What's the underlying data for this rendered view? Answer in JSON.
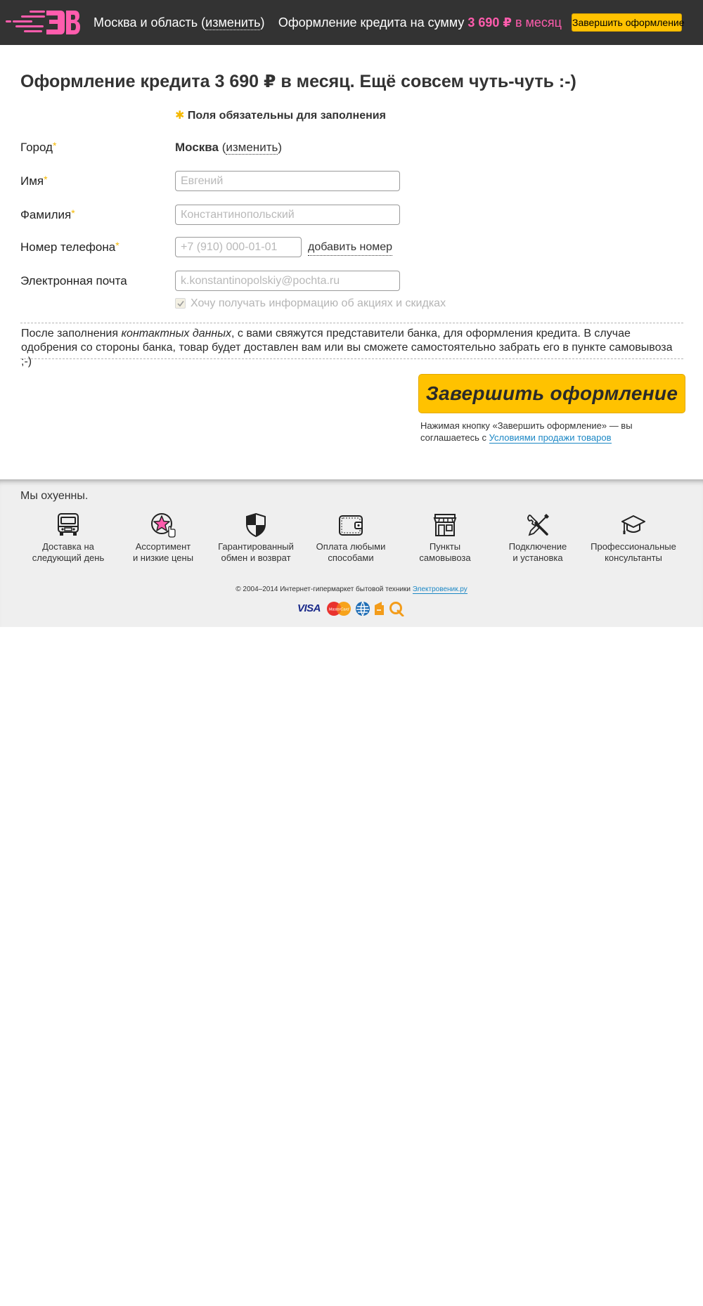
{
  "header": {
    "region_prefix": "Москва и область (",
    "region_change": "изменить",
    "region_suffix": ")",
    "credit_text": "Оформление кредита на сумму",
    "credit_amount": "3 690 ₽",
    "credit_period": "в месяц",
    "finish_button": "Завершить оформление"
  },
  "main": {
    "title_prefix": "Оформление кредита",
    "title_amount": "3 690 ₽",
    "title_suffix": "в месяц. Ещё совсем чуть-чуть :-)",
    "required_star": "✱",
    "required_note": "Поля обязательны для заполнения",
    "required_mark": "*",
    "city": {
      "label": "Город",
      "value": "Москва",
      "change_prefix": "(",
      "change_link": "изменить",
      "change_suffix": ")"
    },
    "first_name": {
      "label": "Имя",
      "placeholder": "Евгений"
    },
    "last_name": {
      "label": "Фамилия",
      "placeholder": "Константинопольский"
    },
    "phone": {
      "label": "Номер телефона",
      "placeholder": "+7 (910) 000-01-01",
      "add_link": "добавить номер"
    },
    "email": {
      "label": "Электронная почта",
      "placeholder": "k.konstantinopolskiy@pochta.ru"
    },
    "subscribe": {
      "label": "Хочу получать информацию об акциях и скидках",
      "checked": true
    },
    "info": {
      "before": "После заполнения ",
      "italic": "контактных данных",
      "after": ", с вами свяжутся представители банка, для оформления кредита. В случае одобрения со стороны банка, товар будет доставлен вам или вы сможете самостоятельно забрать его в пункте самовывоза ;-)"
    },
    "submit_button": "Завершить оформление",
    "agree_text": "Нажимая кнопку «Завершить оформление» — вы соглашаетесь с",
    "agree_link": "Условиями продажи товаров"
  },
  "footer": {
    "tagline": "Мы охуенны.",
    "features": [
      {
        "icon": "delivery-bus-icon",
        "label": "Доставка на\nследующий день"
      },
      {
        "icon": "star-assortment-icon",
        "label": "Ассортимент\nи низкие цены"
      },
      {
        "icon": "shield-icon",
        "label": "Гарантированный\nобмен и возврат"
      },
      {
        "icon": "wallet-icon",
        "label": "Оплата любыми\nспособами"
      },
      {
        "icon": "store-icon",
        "label": "Пункты\nсамовывоза"
      },
      {
        "icon": "tools-icon",
        "label": "Подключение\nи установка"
      },
      {
        "icon": "graduation-cap-icon",
        "label": "Профессиональные\nконсультанты"
      }
    ],
    "copyright": "© 2004–2014 Интернет-гипермаркет бытовой техники",
    "site_link": "Электровеник.ру",
    "payments": {
      "visa": "VISA",
      "mastercard": "MasterCard",
      "icons": [
        "visa-icon",
        "mastercard-icon",
        "webmoney-icon",
        "yandex-money-icon",
        "qiwi-icon"
      ]
    }
  },
  "colors": {
    "header_bg": "#333333",
    "accent_yellow": "#ffc200",
    "accent_pink": "#ff5cad",
    "link_blue": "#1b87c5",
    "footer_bg": "#efefef"
  }
}
